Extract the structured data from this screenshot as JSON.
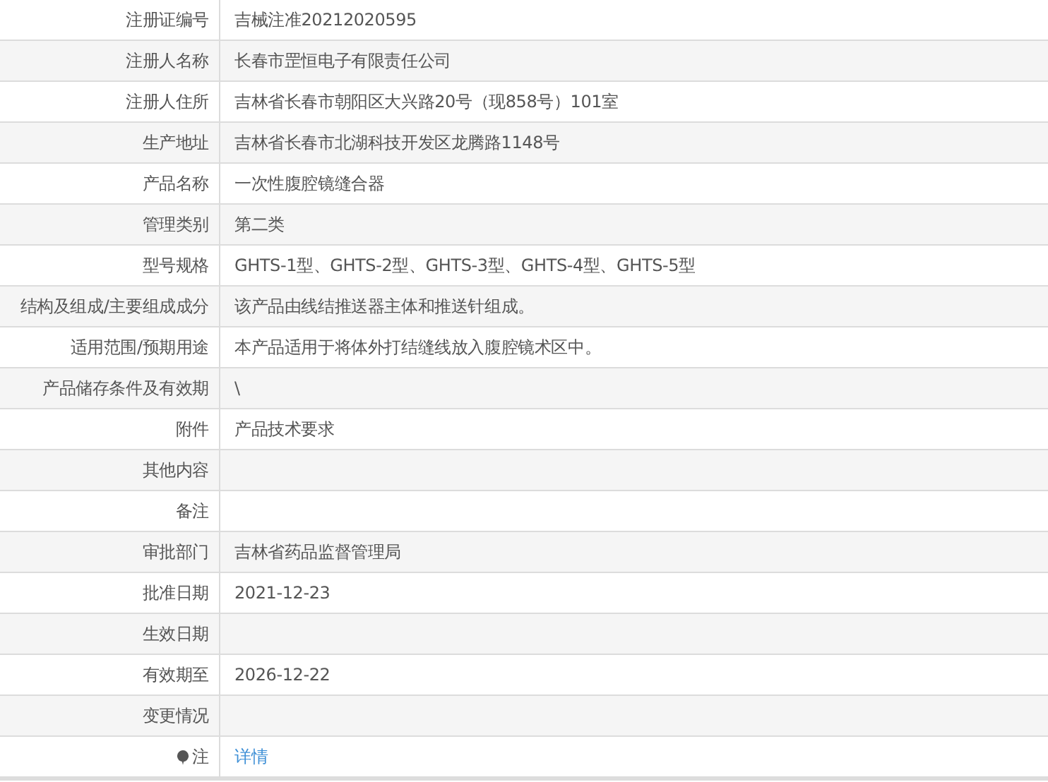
{
  "rows": [
    {
      "kind": "text",
      "label": "注册证编号",
      "value": "吉械注准20212020595"
    },
    {
      "kind": "text",
      "label": "注册人名称",
      "value": "长春市罡恒电子有限责任公司"
    },
    {
      "kind": "text",
      "label": "注册人住所",
      "value": "吉林省长春市朝阳区大兴路20号（现858号）101室"
    },
    {
      "kind": "text",
      "label": "生产地址",
      "value": "吉林省长春市北湖科技开发区龙腾路1148号"
    },
    {
      "kind": "text",
      "label": "产品名称",
      "value": "一次性腹腔镜缝合器"
    },
    {
      "kind": "text",
      "label": "管理类别",
      "value": "第二类"
    },
    {
      "kind": "text",
      "label": "型号规格",
      "value": "GHTS-1型、GHTS-2型、GHTS-3型、GHTS-4型、GHTS-5型"
    },
    {
      "kind": "text",
      "label": "结构及组成/主要组成成分",
      "value": "该产品由线结推送器主体和推送针组成。"
    },
    {
      "kind": "text",
      "label": "适用范围/预期用途",
      "value": "本产品适用于将体外打结缝线放入腹腔镜术区中。"
    },
    {
      "kind": "text",
      "label": "产品储存条件及有效期",
      "value": "\\"
    },
    {
      "kind": "text",
      "label": "附件",
      "value": "产品技术要求"
    },
    {
      "kind": "text",
      "label": "其他内容"
    },
    {
      "kind": "text",
      "label": "备注"
    },
    {
      "kind": "text",
      "label": "审批部门",
      "value": "吉林省药品监督管理局"
    },
    {
      "kind": "text",
      "label": "批准日期",
      "value": "2021-12-23"
    },
    {
      "kind": "text",
      "label": "生效日期"
    },
    {
      "kind": "text",
      "label": "有效期至",
      "value": "2026-12-22"
    },
    {
      "kind": "text",
      "label": "变更情况"
    },
    {
      "kind": "note",
      "label": "注",
      "value": "详情"
    }
  ]
}
